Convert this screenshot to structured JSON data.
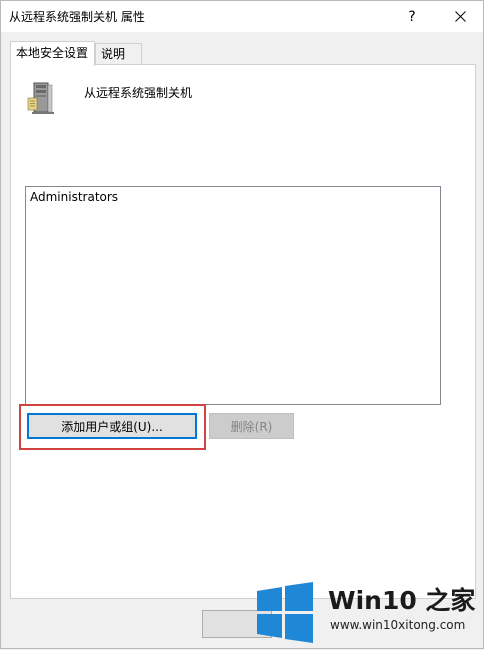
{
  "window": {
    "title": "从远程系统强制关机 属性",
    "help_label": "?",
    "close_icon": "close-icon"
  },
  "tabs": [
    {
      "label": "本地安全设置",
      "active": true
    },
    {
      "label": "说明",
      "active": false
    }
  ],
  "policy": {
    "icon": "server-icon",
    "name": "从远程系统强制关机"
  },
  "assigned_list": {
    "items": [
      "Administrators"
    ]
  },
  "buttons": {
    "add_label": "添加用户或组(U)...",
    "remove_label": "删除(R)"
  },
  "annotation": {
    "highlight_color": "#d14343"
  },
  "watermark": {
    "title": "Win10 之家",
    "url": "www.win10xitong.com",
    "logo_color": "#1e88d6"
  }
}
